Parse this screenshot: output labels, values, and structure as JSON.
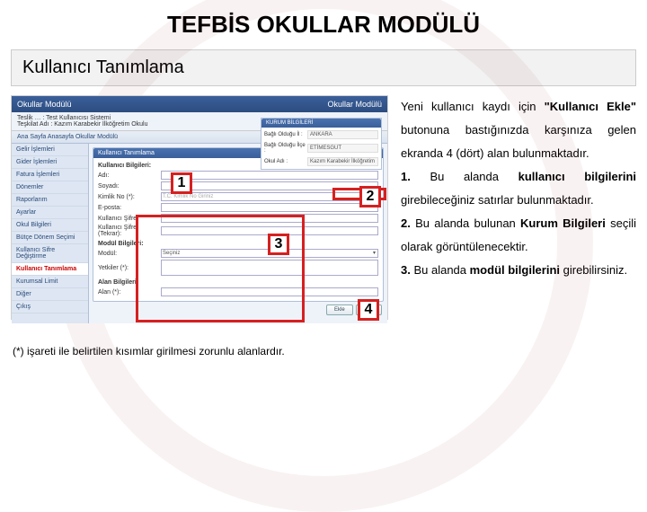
{
  "page": {
    "title": "TEFBİS OKULLAR MODÜLÜ",
    "subtitle": "Kullanıcı Tanımlama"
  },
  "screenshot": {
    "app_left": "Okullar Modülü",
    "app_right": "Okullar Modülü",
    "crumb1": "Teslik … : Test Kullanıcısı Sistemi",
    "crumb2": "Teşkilat Adı : Kazım Karabekir İlköğretim Okulu",
    "tabs": "Ana Sayfa   Anasayfa   Okullar Modülü",
    "sidebar": {
      "items": [
        "Gelir İşlemleri",
        "Gider İşlemleri",
        "Fatura İşlemleri",
        "Dönemler",
        "Raporlarım",
        "Ayarlar"
      ],
      "sub": [
        "Okul Bilgileri",
        "Bütçe Dönem Seçimi",
        "Kullanıcı Sifre Değiştirme"
      ],
      "active": "Kullanıcı Tanımlama",
      "after": [
        "Kurumsal Limit",
        "Diğer",
        "Çıkış"
      ]
    },
    "form": {
      "head": "Kullanıcı Tanımlama",
      "section": "Kullanıcı Bilgileri:",
      "rows": {
        "adi": "Adı:",
        "soyadi": "Soyadı:",
        "tc": "Kimlik No (*):",
        "tc_ph": "T.C. Kimlik No Giriniz",
        "eposta": "E-posta:",
        "sifre": "Kullanıcı Şifre:",
        "sifre2": "Kullanıcı Şifre (Tekrar):"
      },
      "modul": {
        "head": "Modül Bilgileri:",
        "modul": "Modül:",
        "yetkiler": "Yetkiler (*):",
        "sel": "Seçiniz"
      },
      "alan": {
        "head": "Alan Bilgileri:",
        "alan": "Alan (*):"
      }
    },
    "kurum": {
      "head": "KURUM BİLGİLERİ",
      "rows": {
        "il": "Bağlı Olduğu İl :",
        "il_v": "ANKARA",
        "ilce": "Bağlı Olduğu İlçe :",
        "ilce_v": "ETİMESGUT",
        "okul": "Okul Adı :",
        "okul_v": "Kazım Karabekir İlköğretim"
      }
    },
    "buttons": {
      "ekle": "Ekle",
      "iptal": "İptal"
    },
    "toolbar_btn": "Kullanıcı Ekle"
  },
  "callouts": {
    "n1": "1",
    "n2": "2",
    "n3": "3",
    "n4": "4"
  },
  "desc": {
    "p1a": "Yeni kullanıcı kaydı için ",
    "p1b": "\"Kullanıcı Ekle\"",
    "p1c": " butonuna bastığınızda karşınıza gelen ekranda 4 (dört) alan bulunmaktadır.",
    "p2a": "1.",
    "p2b": " Bu alanda ",
    "p2c": "kullanıcı bilgilerini",
    "p2d": " girebileceğiniz satırlar bulunmaktadır.",
    "p3a": "2.",
    "p3b": " Bu alanda bulunan ",
    "p3c": "Kurum Bilgileri",
    "p3d": " seçili olarak görüntülenecektir.",
    "p4a": "3.",
    "p4b": " Bu alanda ",
    "p4c": "modül bilgilerini",
    "p4d": " girebilirsiniz."
  },
  "footnote": "(*) işareti ile belirtilen kısımlar girilmesi zorunlu alanlardır."
}
